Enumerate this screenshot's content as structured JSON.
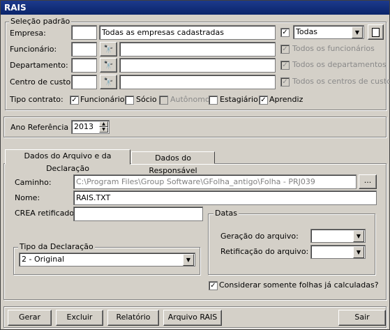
{
  "window": {
    "title": "RAIS"
  },
  "selecao": {
    "legend": "Seleção padrão",
    "empresa": {
      "label": "Empresa:",
      "code": "",
      "name": "Todas as empresas cadastradas",
      "combo_value": "Todas",
      "checked": true
    },
    "funcionario": {
      "label": "Funcionário:",
      "code": "",
      "name": "",
      "check_label": "Todos os funcionários",
      "checked": true
    },
    "departamento": {
      "label": "Departamento:",
      "code": "",
      "name": "",
      "check_label": "Todos os departamentos",
      "checked": true
    },
    "centro": {
      "label": "Centro de custo:",
      "code": "",
      "name": "",
      "check_label": "Todos os centros de custo",
      "checked": true
    },
    "tipo_contrato": {
      "label": "Tipo contrato:",
      "options": [
        {
          "label": "Funcionário",
          "checked": true,
          "enabled": true
        },
        {
          "label": "Sócio",
          "checked": false,
          "enabled": true
        },
        {
          "label": "Autônomo",
          "checked": false,
          "enabled": false
        },
        {
          "label": "Estagiário",
          "checked": false,
          "enabled": true
        },
        {
          "label": "Aprendiz",
          "checked": true,
          "enabled": true
        }
      ]
    }
  },
  "ano": {
    "label": "Ano Referência :",
    "value": "2013"
  },
  "tabs": [
    {
      "label": "Dados do Arquivo e da Declaração",
      "active": true
    },
    {
      "label": "Dados do Responsável",
      "active": false
    }
  ],
  "arquivo": {
    "caminho_label": "Caminho:",
    "caminho_value": "C:\\Program Files\\Group Software\\GFolha_antigo\\Folha - PRJ039",
    "browse_label": "...",
    "nome_label": "Nome:",
    "nome_value": "RAIS.TXT",
    "crea_label": "CREA retificado:",
    "crea_value": "",
    "tipo_decl": {
      "legend": "Tipo da Declaração",
      "value": "2 - Original"
    },
    "datas": {
      "legend": "Datas",
      "geracao_label": "Geração do arquivo:",
      "geracao_value": "",
      "retificacao_label": "Retificação do arquivo:",
      "retificacao_value": ""
    },
    "considerar": {
      "label": "Considerar somente folhas já calculadas?",
      "checked": true
    }
  },
  "buttons": {
    "gerar": "Gerar",
    "excluir": "Excluir",
    "relatorio": "Relatório",
    "arquivo_rais": "Arquivo RAIS",
    "sair": "Sair"
  },
  "check_mark": "✓"
}
